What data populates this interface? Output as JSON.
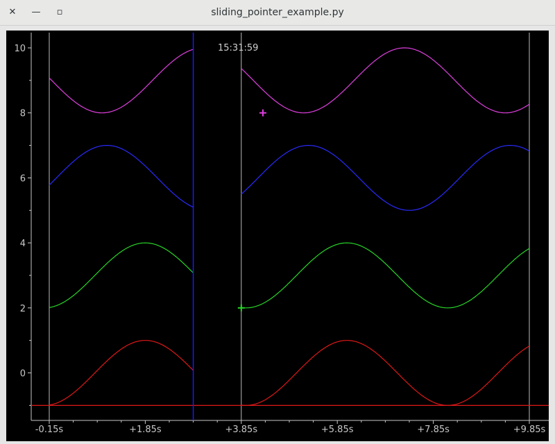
{
  "window": {
    "title": "sliding_pointer_example.py",
    "close_glyph": "✕",
    "minimize_glyph": "—",
    "maximize_glyph": "▫"
  },
  "overlay": {
    "time_label": "15:31:59"
  },
  "chart_data": {
    "type": "line",
    "title": "",
    "xlabel": "",
    "ylabel": "",
    "x_tick_labels": [
      "-0.15s",
      "+1.85s",
      "+3.85s",
      "+5.85s",
      "+7.85s",
      "+9.85s"
    ],
    "x_tick_values": [
      -0.15,
      1.85,
      3.85,
      5.85,
      7.85,
      9.85
    ],
    "y_tick_labels": [
      "0",
      "2",
      "4",
      "6",
      "8",
      "10"
    ],
    "y_tick_values": [
      0,
      2,
      4,
      6,
      8,
      10
    ],
    "xlim": [
      -0.15,
      9.85
    ],
    "ylim": [
      -1,
      10.5
    ],
    "grid": false,
    "colors": {
      "background": "#000000",
      "axis": "#c8c8c8",
      "magenta": "#e040e0",
      "blue": "#2a2aff",
      "green": "#28d628",
      "red": "#e01818",
      "cursor_line": "#1a1aff"
    },
    "series": [
      {
        "color": "#e040e0",
        "offset": 9,
        "amplitude": 1,
        "period": 4.2,
        "phase_peak_x": 3.05
      },
      {
        "color": "#2a2aff",
        "offset": 6,
        "amplitude": 1,
        "period": 4.2,
        "phase_peak_x": 1.05
      },
      {
        "color": "#28d628",
        "offset": 3,
        "amplitude": 1,
        "period": 4.2,
        "phase_peak_x": 1.85
      },
      {
        "color": "#e01818",
        "offset": 0,
        "amplitude": 1,
        "period": 4.2,
        "phase_peak_x": 1.85
      }
    ],
    "sweep_x": 3.85,
    "gap_x": [
      2.85,
      3.85
    ],
    "cursor_x": 2.85,
    "baseline_y": -1,
    "markers": [
      {
        "x": 4.3,
        "y": 8,
        "color": "#e040e0"
      },
      {
        "x": 3.85,
        "y": 2,
        "color": "#28d628"
      }
    ]
  }
}
